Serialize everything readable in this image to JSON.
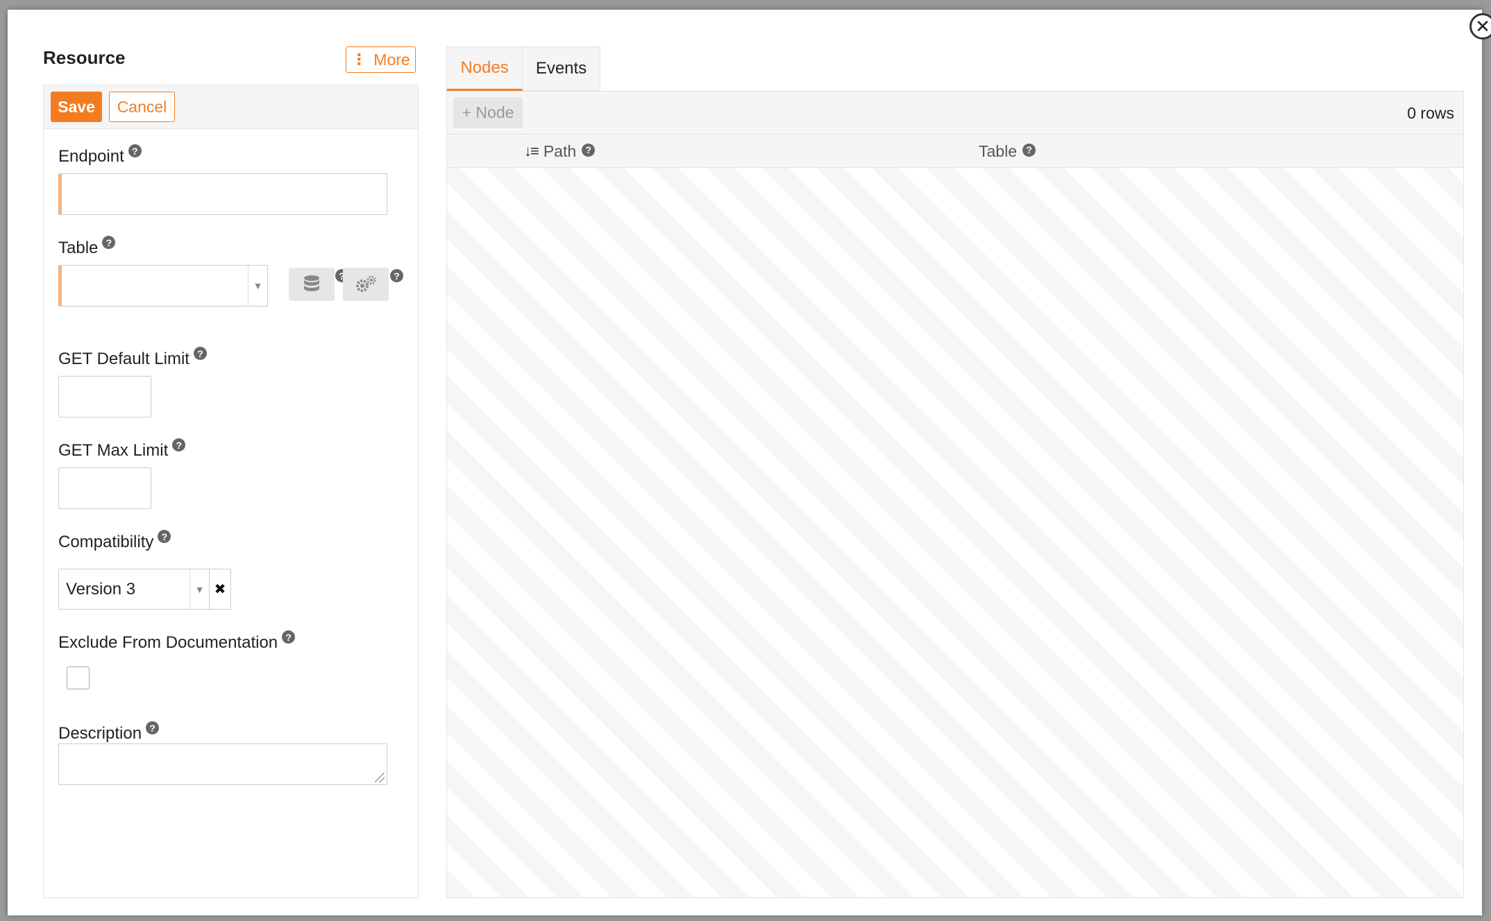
{
  "dialog": {
    "close_icon": "close-icon"
  },
  "left_panel": {
    "title": "Resource",
    "more_label": "More",
    "save_label": "Save",
    "cancel_label": "Cancel",
    "fields": {
      "endpoint": {
        "label": "Endpoint",
        "value": ""
      },
      "table": {
        "label": "Table",
        "value": ""
      },
      "get_default_limit": {
        "label": "GET Default Limit",
        "value": ""
      },
      "get_max_limit": {
        "label": "GET Max Limit",
        "value": ""
      },
      "compatibility": {
        "label": "Compatibility",
        "value": "Version 3"
      },
      "exclude_from_documentation": {
        "label": "Exclude From Documentation",
        "checked": false
      },
      "description": {
        "label": "Description",
        "value": ""
      }
    },
    "help_glyph": "?"
  },
  "right_panel": {
    "tabs": [
      {
        "label": "Nodes",
        "active": true
      },
      {
        "label": "Events",
        "active": false
      }
    ],
    "add_node_label": "+ Node",
    "row_count": "0 rows",
    "columns": [
      {
        "label": "Path",
        "sorted": true
      },
      {
        "label": "Table",
        "sorted": false
      }
    ]
  },
  "colors": {
    "accent": "#f47c20",
    "required_marker": "#f7b37a"
  }
}
